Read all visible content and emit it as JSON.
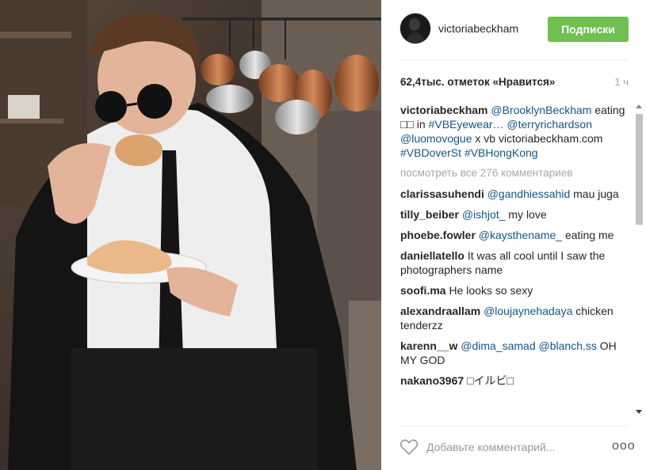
{
  "post": {
    "username": "victoriabeckham",
    "follow_label": "Подписки",
    "likes": "62,4тыс. отметок «Нравится»",
    "time": "1 ч",
    "caption": {
      "username": "victoriabeckham",
      "parts": [
        {
          "type": "link",
          "text": "@BrooklynBeckham"
        },
        {
          "type": "text",
          "text": " eating □□ in "
        },
        {
          "type": "link",
          "text": "#VBEyewear…"
        },
        {
          "type": "text",
          "text": " "
        },
        {
          "type": "link",
          "text": "@terryrichardson"
        },
        {
          "type": "text",
          "text": " "
        },
        {
          "type": "link",
          "text": "@luomovogue"
        },
        {
          "type": "text",
          "text": " x vb victoriabeckham.com "
        },
        {
          "type": "link",
          "text": "#VBDoverSt"
        },
        {
          "type": "text",
          "text": " "
        },
        {
          "type": "link",
          "text": "#VBHongKong"
        }
      ]
    },
    "view_all_comments": "посмотреть все 276 комментариев",
    "comments": [
      {
        "user": "clarissasuhendi",
        "mention": "@gandhiessahid",
        "text": " mau juga"
      },
      {
        "user": "tilly_beiber",
        "mention": "@ishjot_",
        "text": " my love"
      },
      {
        "user": "phoebe.fowler",
        "mention": "@kaysthename_",
        "text": " eating me"
      },
      {
        "user": "daniellatello",
        "mention": "",
        "text": "It was all cool until I saw the photographers name"
      },
      {
        "user": "soofi.ma",
        "mention": "",
        "text": "He looks so sexy"
      },
      {
        "user": "alexandraallam",
        "mention": "@loujaynehadaya",
        "text": " chicken tenderzz"
      },
      {
        "user": "karenn__w",
        "mention": "@dima_samad @blanch.ss",
        "text": " OH MY GOD"
      },
      {
        "user": "nakano3967",
        "mention": "",
        "text": "□イルビ□"
      }
    ],
    "comment_placeholder": "Добавьте комментарий...",
    "more_label": "ooo"
  },
  "icons": {
    "heart": "heart-outline-icon",
    "more": "more-options-icon"
  },
  "colors": {
    "follow_bg": "#70c050",
    "link": "#125688",
    "muted": "#a5a7aa"
  }
}
